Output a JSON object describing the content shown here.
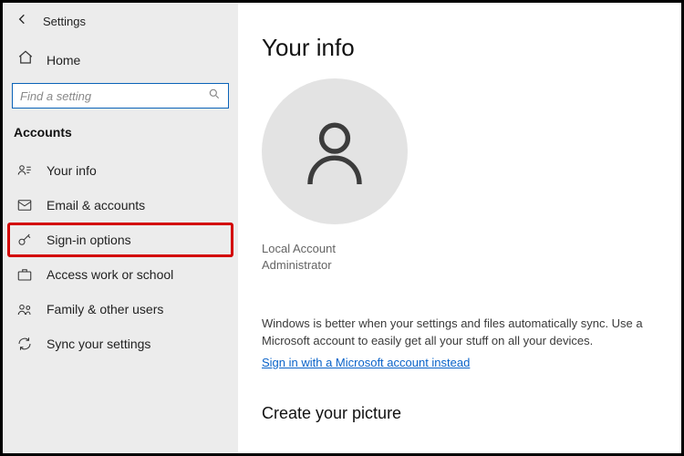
{
  "titlebar": {
    "title": "Settings"
  },
  "home_label": "Home",
  "search": {
    "placeholder": "Find a setting"
  },
  "section": "Accounts",
  "nav": [
    {
      "label": "Your info"
    },
    {
      "label": "Email & accounts"
    },
    {
      "label": "Sign-in options"
    },
    {
      "label": "Access work or school"
    },
    {
      "label": "Family & other users"
    },
    {
      "label": "Sync your settings"
    }
  ],
  "main": {
    "heading": "Your info",
    "account_type": "Local Account",
    "role": "Administrator",
    "blurb": "Windows is better when your settings and files automatically sync. Use a Microsoft account to easily get all your stuff on all your devices.",
    "link": "Sign in with a Microsoft account instead",
    "picture_heading": "Create your picture"
  }
}
